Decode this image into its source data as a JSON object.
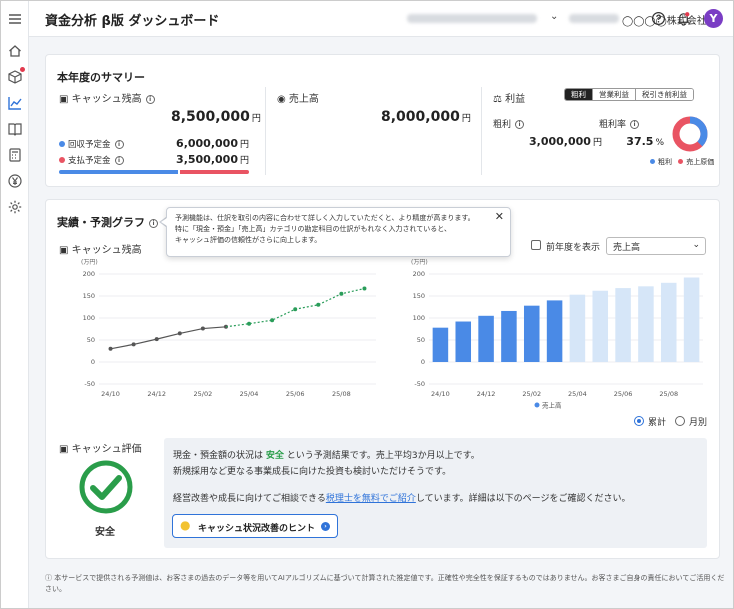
{
  "header": {
    "title": "資金分析 β版 ダッシュボード",
    "company": "◯◯◯◯株式会社",
    "avatar_letter": "Y"
  },
  "summary": {
    "title": "本年度のサマリー",
    "cash": {
      "label": "キャッシュ残高",
      "amount": "8,500,000",
      "unit": "円",
      "collect_label": "回収予定金",
      "collect_amount": "6,000,000",
      "pay_label": "支払予定金",
      "pay_amount": "3,500,000",
      "collect_ratio": 0.632
    },
    "sales": {
      "label": "売上高",
      "amount": "8,000,000",
      "unit": "円"
    },
    "profit": {
      "label": "利益",
      "tabs": [
        "粗利",
        "営業利益",
        "税引き前利益"
      ],
      "active_tab": 0,
      "gross_label": "粗利",
      "gross_amount": "3,000,000",
      "gross_unit": "円",
      "rate_label": "粗利率",
      "rate_value": "37.5",
      "rate_unit": "%",
      "rate_fraction": 0.375,
      "legend": [
        "粗利",
        "売上原価"
      ]
    }
  },
  "graph": {
    "title": "実績・予測グラフ",
    "cash_label": "キャッシュ残高",
    "tooltip": {
      "line1": "予測機能は、仕訳を取引の内容に合わせて詳しく入力していただくと、より精度が高まります。",
      "line2": "特に「現金・預金」「売上高」カテゴリの勘定科目の仕訳がもれなく入力されていると、",
      "line3": "キャッシュ評価の信頼性がさらに向上します。"
    },
    "prev_year_label": "前年度を表示",
    "select_value": "売上高",
    "radio_cumulative": "累計",
    "radio_monthly": "月別",
    "bar_legend": "売上高"
  },
  "chart_data": [
    {
      "type": "line",
      "unit_label": "(万円)",
      "x_tick_labels": [
        "24/10",
        "24/12",
        "25/02",
        "25/04",
        "25/06",
        "25/08"
      ],
      "ylim": [
        -50,
        200
      ],
      "y_ticks": [
        -50,
        0,
        50,
        100,
        150,
        200
      ],
      "series": [
        {
          "style": "solid",
          "values": [
            30,
            40,
            52,
            65,
            76,
            80,
            null,
            null,
            null,
            null,
            null,
            null
          ]
        },
        {
          "style": "dashed",
          "values": [
            null,
            null,
            null,
            null,
            null,
            80,
            87,
            95,
            120,
            130,
            155,
            167
          ]
        }
      ]
    },
    {
      "type": "bar",
      "unit_label": "(万円)",
      "x_tick_labels": [
        "24/10",
        "24/12",
        "25/02",
        "25/04",
        "25/06",
        "25/08"
      ],
      "ylim": [
        -50,
        200
      ],
      "y_ticks": [
        -50,
        0,
        50,
        100,
        150,
        200
      ],
      "series": [
        {
          "name": "売上高",
          "values": [
            78,
            92,
            105,
            116,
            128,
            140,
            null,
            null,
            null,
            null,
            null,
            null
          ]
        },
        {
          "style": "forecast",
          "values": [
            null,
            null,
            null,
            null,
            null,
            null,
            153,
            162,
            168,
            172,
            180,
            192
          ]
        }
      ]
    }
  ],
  "evaluation": {
    "label": "キャッシュ評価",
    "status": "安全",
    "line1_pre": "現金・預金額の状況は",
    "line1_status": "安全",
    "line1_post": "という予測結果です。売上平均3か月以上です。",
    "line2": "新規採用など更なる事業成長に向けた投資も検討いただけそうです。",
    "line3_pre": "経営改善や成長に向けてご相談できる",
    "line3_link": "税理士を無料でご紹介",
    "line3_post": "しています。詳細は以下のページをご確認ください。",
    "hint_button": "キャッシュ状況改善のヒント"
  },
  "disclaimer": "本サービスで提供される予測値は、お客さまの過去のデータ等を用いてAIアルゴリズムに基づいて計算された推定値です。正確性や完全性を保証するものではありません。お客さまご自身の責任においてご活用ください。",
  "colors": {
    "primary": "#2f73d9",
    "bar_actual": "#4a8ae6",
    "bar_forecast": "#d6e6f8",
    "pay": "#e95463",
    "line": "#555555",
    "forecast_line": "#2a9d5a",
    "safe": "#2a9d4a"
  },
  "icons": {
    "sidebar": [
      "menu-icon",
      "home-icon",
      "box-icon",
      "chart-icon",
      "book-icon",
      "calculator-icon",
      "yen-icon",
      "gear-icon"
    ]
  }
}
